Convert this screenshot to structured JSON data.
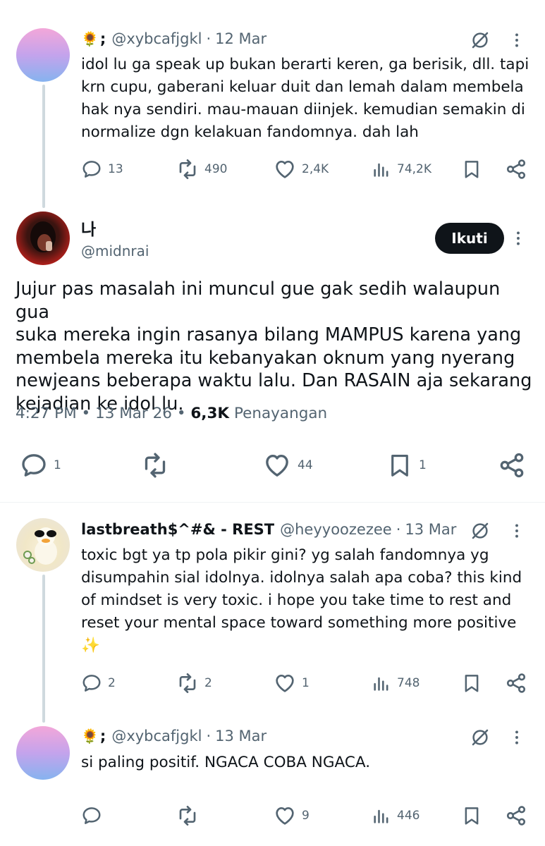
{
  "reply1": {
    "emoji": "🌻",
    "semicolon": ";",
    "handle": "@xybcafjgkl",
    "dot": "·",
    "date": "12 Mar",
    "text": "idol lu ga speak up bukan berarti keren, ga berisik, dll. tapi\nkrn cupu, gaberani keluar duit dan lemah dalam membela\nhak nya sendiri. mau-mauan diinjek. kemudian semakin di\nnormalize dgn kelakuan fandomnya. dah lah",
    "replies": "13",
    "reposts": "490",
    "likes": "2,4K",
    "views": "74,2K"
  },
  "main": {
    "name": "나",
    "handle": "@midnrai",
    "follow_label": "Ikuti",
    "text": "Jujur pas masalah ini muncul gue gak sedih walaupun gua\nsuka mereka ingin rasanya bilang MAMPUS karena yang\nmembela mereka itu kebanyakan oknum yang nyerang\nnewjeans beberapa waktu lalu. Dan RASAIN aja sekarang\nkejadian ke idol lu.",
    "time": "4:27 PM",
    "bullet": "•",
    "date": "13 Mar 26",
    "views_count": "6,3K",
    "views_label": "Penayangan",
    "replies": "1",
    "likes": "44",
    "bookmarks": "1"
  },
  "reply2": {
    "name": "lastbreath$^#& - REST",
    "handle": "@heyyoozezee",
    "dot": "·",
    "date": "13 Mar",
    "text": "toxic bgt ya tp pola pikir gini? yg salah fandomnya yg\ndisumpahin sial idolnya. idolnya salah apa coba? this kind\nof mindset is very toxic. i hope you take time to rest and\nreset your mental space toward something more positive\n✨",
    "replies": "2",
    "reposts": "2",
    "likes": "1",
    "views": "748"
  },
  "reply3": {
    "emoji": "🌻",
    "semicolon": ";",
    "handle": "@xybcafjgkl",
    "dot": "·",
    "date": "13 Mar",
    "text": "si paling positif. NGACA COBA NGACA.",
    "likes": "9",
    "views": "446"
  },
  "icons": {
    "grok": "grok-slash-circle-icon",
    "more": "more-vertical-icon",
    "reply": "reply-bubble-icon",
    "repost": "repost-arrows-icon",
    "like": "heart-icon",
    "views": "analytics-bars-icon",
    "bookmark": "bookmark-icon",
    "share": "share-nodes-icon"
  },
  "colors": {
    "text": "#0f1419",
    "secondary": "#536471",
    "thread_line": "#cfd9de",
    "follow_bg": "#0f1419"
  }
}
